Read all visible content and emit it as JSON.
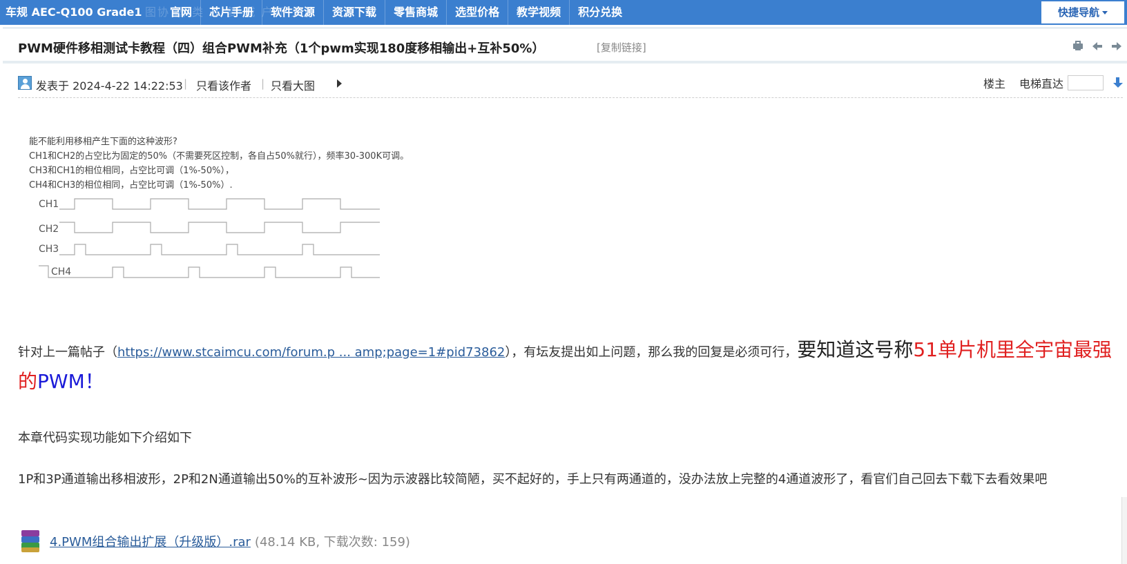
{
  "topnav": {
    "brand": "车规 AEC-Q100 Grade1",
    "ghost_text": "图协 团 类 开 复 城 户标 文草",
    "links": [
      "官网",
      "芯片手册",
      "软件资源",
      "资源下载",
      "零售商城",
      "选型价格",
      "教学视频",
      "积分兑换"
    ],
    "quick_nav": "快捷导航"
  },
  "thread": {
    "title": "PWM硬件移相测试卡教程（四）组合PWM补充（1个pwm实现180度移相输出+互补50%）",
    "copy_link": "[复制链接]"
  },
  "post": {
    "posted": "发表于 2024-4-22 14:22:53",
    "only_author": "只看该作者",
    "only_big_image": "只看大图",
    "floor": "楼主",
    "elevator": "电梯直达",
    "elevator_value": ""
  },
  "image": {
    "lines": [
      "能不能利用移相产生下面的这种波形?",
      "CH1和CH2的占空比为固定的50%（不需要死区控制，各自占50%就行），频率30-300K可调。",
      "CH3和CH1的相位相同，占空比可调（1%-50%），",
      "CH4和CH3的相位相同，占空比可调（1%-50%）."
    ],
    "channels": [
      "CH1",
      "CH2",
      "CH3",
      "CH4"
    ]
  },
  "body": {
    "p1_prefix": "针对上一篇帖子（",
    "p1_link": "https://www.stcaimcu.com/forum.p ... amp;page=1#pid73862",
    "p1_middle": "），有坛友提出如上问题，那么我的回复是必须可行，",
    "p1_big": "要知道这号称",
    "p1_red": "51单片机里全宇宙最强的",
    "p1_blue": "PWM！",
    "p2": "本章代码实现功能如下介绍如下",
    "p3": "1P和3P通道输出移相波形，2P和2N通道输出50%的互补波形~因为示波器比较简陋，买不起好的，手上只有两通道的，没办法放上完整的4通道波形了，看官们自己回去下载下去看效果吧"
  },
  "attachment": {
    "name": "4.PWM组合输出扩展（升级版）.rar",
    "meta": "(48.14 KB, 下载次数: 159)"
  }
}
